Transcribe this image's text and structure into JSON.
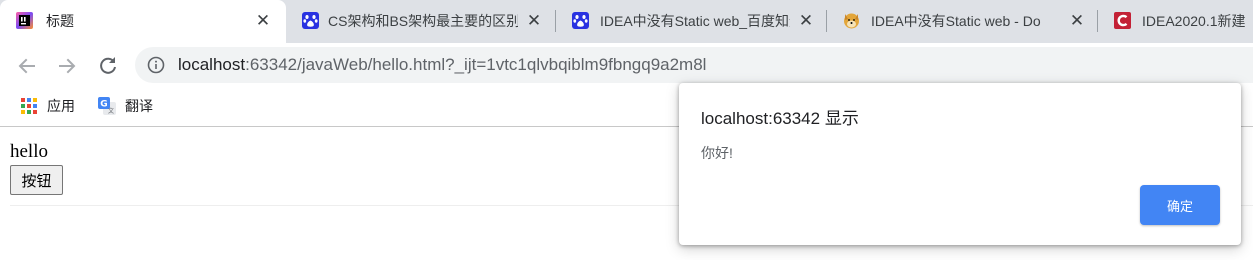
{
  "tabs": [
    {
      "title": "标题",
      "favicon": "intellij-icon",
      "active": true
    },
    {
      "title": "CS架构和BS架构最主要的区别",
      "favicon": "baidu-paw-icon",
      "active": false
    },
    {
      "title": "IDEA中没有Static web_百度知道",
      "favicon": "baidu-paw-icon",
      "active": false
    },
    {
      "title": "IDEA中没有Static web - Do",
      "favicon": "shiba-dog-icon",
      "active": false
    },
    {
      "title": "IDEA2020.1新建",
      "favicon": "csdn-icon",
      "active": false
    }
  ],
  "toolbar": {
    "url_host": "localhost",
    "url_rest": ":63342/javaWeb/hello.html?_ijt=1vtc1qlvbqiblm9fbngq9a2m8l"
  },
  "bookmarks": [
    {
      "label": "应用",
      "icon": "apps-grid-icon"
    },
    {
      "label": "翻译",
      "icon": "google-translate-icon"
    }
  ],
  "page": {
    "heading": "hello",
    "button_label": "按钮"
  },
  "dialog": {
    "title": "localhost:63342 显示",
    "message": "你好!",
    "ok_label": "确定"
  },
  "colors": {
    "tabstrip_bg": "#dee1e6",
    "omnibox_bg": "#f1f3f4",
    "dialog_button": "#4285f4"
  }
}
